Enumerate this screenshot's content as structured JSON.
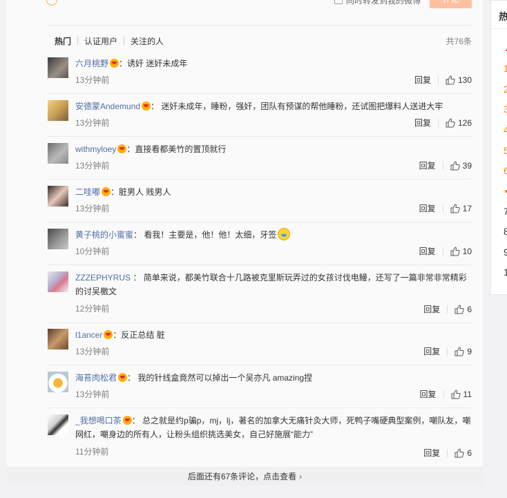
{
  "composer": {
    "forward_label": "同时转发到我的微博",
    "submit_label": "评论"
  },
  "tabs": [
    {
      "label": "热门",
      "active": true
    },
    {
      "label": "认证用户",
      "active": false
    },
    {
      "label": "关注的人",
      "active": false
    }
  ],
  "total_count": "共76条",
  "reply_label": "回复",
  "comments": [
    {
      "user": "六月桃野",
      "text": "诱奸 迷奸未成年",
      "time": "13分钟前",
      "likes": "130"
    },
    {
      "user": "安德蒙Andemund",
      "text": "迷奸未成年，睡粉，强奸，团队有预谋的帮他睡粉，还试图把爆料人送进大牢",
      "time": "13分钟前",
      "likes": "126"
    },
    {
      "user": "withmyloey",
      "text": "直接看都美竹的置顶就行",
      "time": "13分钟前",
      "likes": "39"
    },
    {
      "user": "二哇嘟",
      "text": "脏男人 贱男人",
      "time": "13分钟前",
      "likes": "17"
    },
    {
      "user": "黄子桃的小蜜蜜",
      "text": "看我！主要是，他！他！太细，牙签",
      "time": "10分钟前",
      "likes": "10"
    },
    {
      "user": "ZZZEPHYRUS",
      "text": "简单来说，都美竹联合十几路被克里斯玩弄过的女孩讨伐电鳗，还写了一篇非常非常精彩的讨吴檄文",
      "time": "12分钟前",
      "likes": "6"
    },
    {
      "user": "l1ancer",
      "text": "反正总结 脏",
      "time": "13分钟前",
      "likes": "9"
    },
    {
      "user": "海苔肉松君",
      "text": "我的针线盒竟然可以掉出一个吴亦凡 amazing捏",
      "time": "13分钟前",
      "likes": "11"
    },
    {
      "user": "_我想喝口茶",
      "text": "总之就是约p骗p，mj，lj，著名的加拿大无痛针灸大师，死鸭子嘴硬典型案例，嘲队友，嘲网红，嘲身边的所有人，让粉头组织挑选美女，自己好施展“能力”",
      "time": "11分钟前",
      "likes": "6"
    }
  ],
  "more_comments": "后面还有67条评论，点击查看",
  "side_panel": {
    "title": "热",
    "items": [
      "1",
      "2",
      "3",
      "4",
      "5",
      "6",
      "7",
      "8",
      "9",
      "1"
    ]
  },
  "colors": {
    "username": "#4e6ea6",
    "accent": "#ff8200",
    "submit_disabled": "#ffc09f"
  }
}
